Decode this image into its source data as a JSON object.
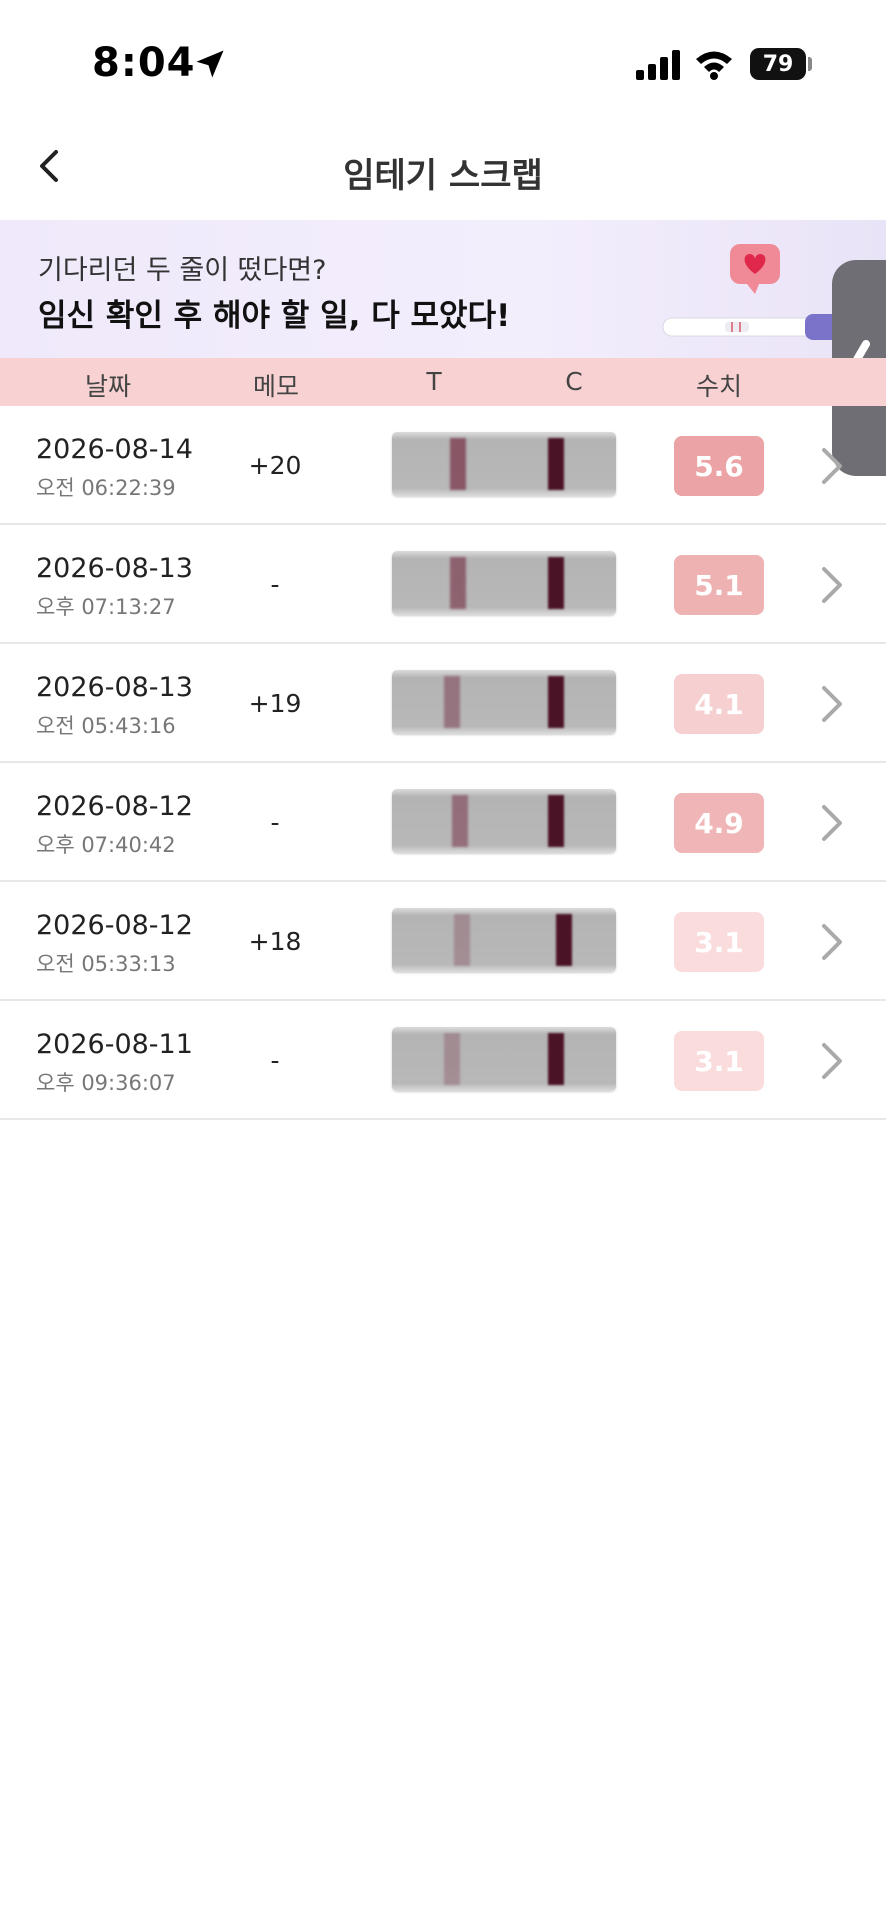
{
  "status_bar": {
    "time": "8:04",
    "battery": "79"
  },
  "header": {
    "title": "임테기 스크랩"
  },
  "banner": {
    "subtitle": "기다리던 두 줄이 떴다면?",
    "headline": "임신 확인 후 해야 할 일, 다 모았다!"
  },
  "columns": {
    "date": "날짜",
    "memo": "메모",
    "t": "T",
    "c": "C",
    "value": "수치"
  },
  "rows": [
    {
      "date": "2026-08-14",
      "time": "오전 06:22:39",
      "memo": "+20",
      "value": "5.6",
      "t_intensity": 0.8,
      "badge_color": "#eba3a5"
    },
    {
      "date": "2026-08-13",
      "time": "오후 07:13:27",
      "memo": "-",
      "value": "5.1",
      "t_intensity": 0.7,
      "badge_color": "#efb2b3"
    },
    {
      "date": "2026-08-13",
      "time": "오전 05:43:16",
      "memo": "+19",
      "value": "4.1",
      "t_intensity": 0.55,
      "badge_color": "#f6cfd0"
    },
    {
      "date": "2026-08-12",
      "time": "오후 07:40:42",
      "memo": "-",
      "value": "4.9",
      "t_intensity": 0.6,
      "badge_color": "#f0b6b7"
    },
    {
      "date": "2026-08-12",
      "time": "오전 05:33:13",
      "memo": "+18",
      "value": "3.1",
      "t_intensity": 0.35,
      "badge_color": "#fadcdd"
    },
    {
      "date": "2026-08-11",
      "time": "오후 09:36:07",
      "memo": "-",
      "value": "3.1",
      "t_intensity": 0.35,
      "badge_color": "#fadcdd"
    }
  ]
}
